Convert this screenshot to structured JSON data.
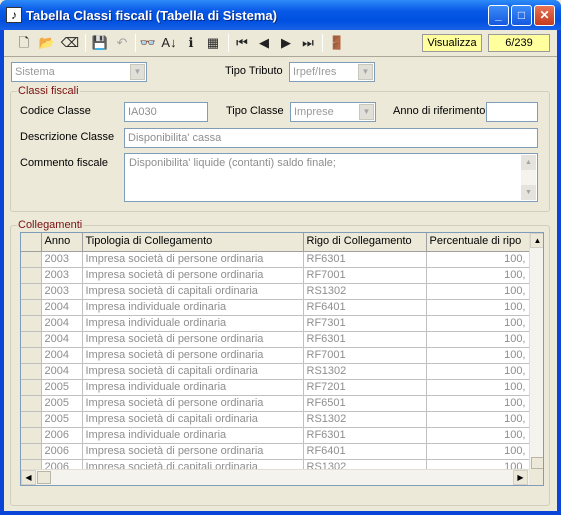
{
  "window": {
    "title": "Tabella Classi fiscali (Tabella di Sistema)",
    "minimize_glyph": "_",
    "maximize_glyph": "□",
    "close_glyph": "✕",
    "app_icon": "music-note-icon",
    "app_icon_glyph": "♪"
  },
  "toolbar": {
    "tools": [
      {
        "name": "new-icon",
        "glyph": "🗋"
      },
      {
        "name": "open-folder-icon",
        "glyph": "📂"
      },
      {
        "name": "eraser-icon",
        "glyph": "⌫"
      },
      {
        "name": "save-icon",
        "glyph": "💾"
      },
      {
        "name": "undo-icon",
        "glyph": "↶"
      },
      {
        "name": "binoculars-icon",
        "glyph": "👓"
      },
      {
        "name": "sort-az-icon",
        "glyph": "A↓"
      },
      {
        "name": "info-icon",
        "glyph": "ℹ"
      },
      {
        "name": "grid-icon",
        "glyph": "▦"
      },
      {
        "name": "first-record-icon",
        "glyph": "⏮"
      },
      {
        "name": "prev-record-icon",
        "glyph": "◀"
      },
      {
        "name": "next-record-icon",
        "glyph": "▶"
      },
      {
        "name": "last-record-icon",
        "glyph": "⏭"
      },
      {
        "name": "exit-door-icon",
        "glyph": "🚪"
      }
    ],
    "mode": "Visualizza",
    "record_counter": "6/239"
  },
  "filters": {
    "system_combo": "Sistema",
    "tipo_tributo_label": "Tipo Tributo",
    "tipo_tributo_value": "Irpef/Ires"
  },
  "classi_fiscali": {
    "group_title": "Classi fiscali",
    "codice_classe_label": "Codice Classe",
    "codice_classe_value": "IA030",
    "tipo_classe_label": "Tipo Classe",
    "tipo_classe_value": "Imprese",
    "anno_label": "Anno di riferimento",
    "anno_value": "",
    "descrizione_label": "Descrizione Classe",
    "descrizione_value": "Disponibilita' cassa",
    "commento_label": "Commento fiscale",
    "commento_value": "Disponibilita' liquide (contanti) saldo finale;"
  },
  "collegamenti": {
    "group_title": "Collegamenti",
    "columns": [
      "Anno",
      "Tipologia di Collegamento",
      "Rigo di Collegamento",
      "Percentuale di ripo"
    ],
    "sort_indicator": "▲",
    "rows": [
      {
        "anno": "2003",
        "tipologia": "Impresa società di persone ordinaria",
        "rigo": "RF6301",
        "perc": "100,"
      },
      {
        "anno": "2003",
        "tipologia": "Impresa società di persone ordinaria",
        "rigo": "RF7001",
        "perc": "100,"
      },
      {
        "anno": "2003",
        "tipologia": "Impresa società di capitali ordinaria",
        "rigo": "RS1302",
        "perc": "100,"
      },
      {
        "anno": "2004",
        "tipologia": "Impresa individuale ordinaria",
        "rigo": "RF6401",
        "perc": "100,"
      },
      {
        "anno": "2004",
        "tipologia": "Impresa individuale ordinaria",
        "rigo": "RF7301",
        "perc": "100,"
      },
      {
        "anno": "2004",
        "tipologia": "Impresa società di persone ordinaria",
        "rigo": "RF6301",
        "perc": "100,"
      },
      {
        "anno": "2004",
        "tipologia": "Impresa società di persone ordinaria",
        "rigo": "RF7001",
        "perc": "100,"
      },
      {
        "anno": "2004",
        "tipologia": "Impresa società di capitali ordinaria",
        "rigo": "RS1302",
        "perc": "100,"
      },
      {
        "anno": "2005",
        "tipologia": "Impresa individuale ordinaria",
        "rigo": "RF7201",
        "perc": "100,"
      },
      {
        "anno": "2005",
        "tipologia": "Impresa società di persone ordinaria",
        "rigo": "RF6501",
        "perc": "100,"
      },
      {
        "anno": "2005",
        "tipologia": "Impresa società di capitali ordinaria",
        "rigo": "RS1302",
        "perc": "100,"
      },
      {
        "anno": "2006",
        "tipologia": "Impresa individuale ordinaria",
        "rigo": "RF6301",
        "perc": "100,"
      },
      {
        "anno": "2006",
        "tipologia": "Impresa società di persone ordinaria",
        "rigo": "RF6401",
        "perc": "100,"
      },
      {
        "anno": "2006",
        "tipologia": "Impresa società di capitali ordinaria",
        "rigo": "RS1302",
        "perc": "100,"
      }
    ]
  }
}
